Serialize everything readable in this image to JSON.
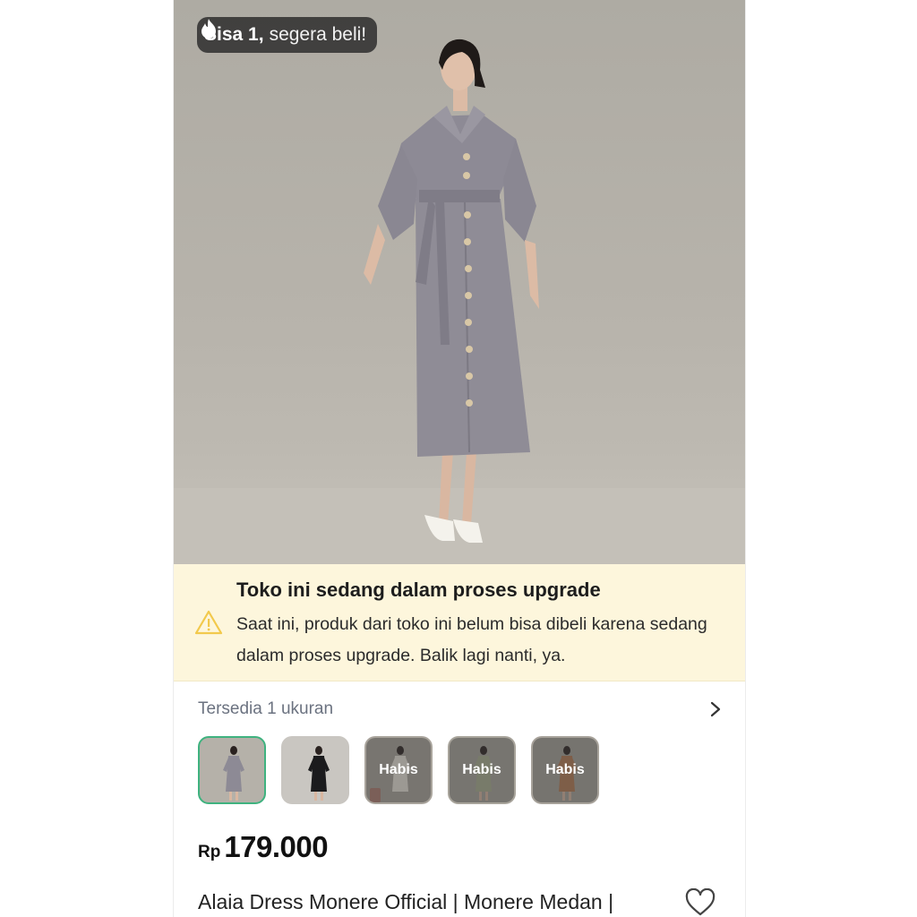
{
  "stock": {
    "count_label": "Sisa 1,",
    "urgency_label": "segera beli!",
    "icon": "fire-icon"
  },
  "notice": {
    "icon": "warning-icon",
    "title": "Toko ini sedang dalam proses upgrade",
    "body": "Saat ini, produk dari toko ini belum bisa dibeli karena sedang dalam proses upgrade. Balik lagi nanti, ya.",
    "accent": "#fdf6dc",
    "icon_color": "#f2c94c"
  },
  "variants": {
    "size_label": "Tersedia 1 ukuran",
    "selected_color": "#3fb27f",
    "items": [
      {
        "name": "variant-grey",
        "overlay": ""
      },
      {
        "name": "variant-black",
        "overlay": ""
      },
      {
        "name": "variant-cream",
        "overlay": "Habis"
      },
      {
        "name": "variant-sage",
        "overlay": "Habis"
      },
      {
        "name": "variant-brown",
        "overlay": "Habis"
      }
    ]
  },
  "product": {
    "currency": "Rp",
    "price": "179.000",
    "title": "Alaia Dress Monere Official | Monere Medan |"
  }
}
